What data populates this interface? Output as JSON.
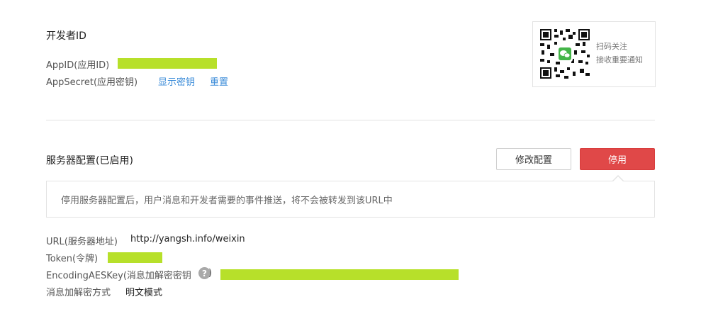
{
  "developer": {
    "title": "开发者ID",
    "appid_label": "AppID(应用ID)",
    "appsecret_label": "AppSecret(应用密钥)",
    "show_secret_link": "显示密钥",
    "reset_link": "重置"
  },
  "qr": {
    "line1": "扫码关注",
    "line2": "接收重要通知"
  },
  "server": {
    "title": "服务器配置(已启用)",
    "modify_button": "修改配置",
    "disable_button": "停用",
    "notice": "停用服务器配置后，用户消息和开发者需要的事件推送，将不会被转发到该URL中"
  },
  "config": {
    "url_label": "URL(服务器地址)",
    "url_value": "http://yangsh.info/weixin",
    "token_label": "Token(令牌)",
    "aeskey_label": "EncodingAESKey(消息加解密密钥",
    "aeskey_suffix": ")",
    "help_glyph": "?",
    "mode_label": "消息加解密方式",
    "mode_value": "明文模式"
  },
  "colors": {
    "redaction": "#b7e02a",
    "danger": "#e04848",
    "link": "#3a8bd8"
  }
}
